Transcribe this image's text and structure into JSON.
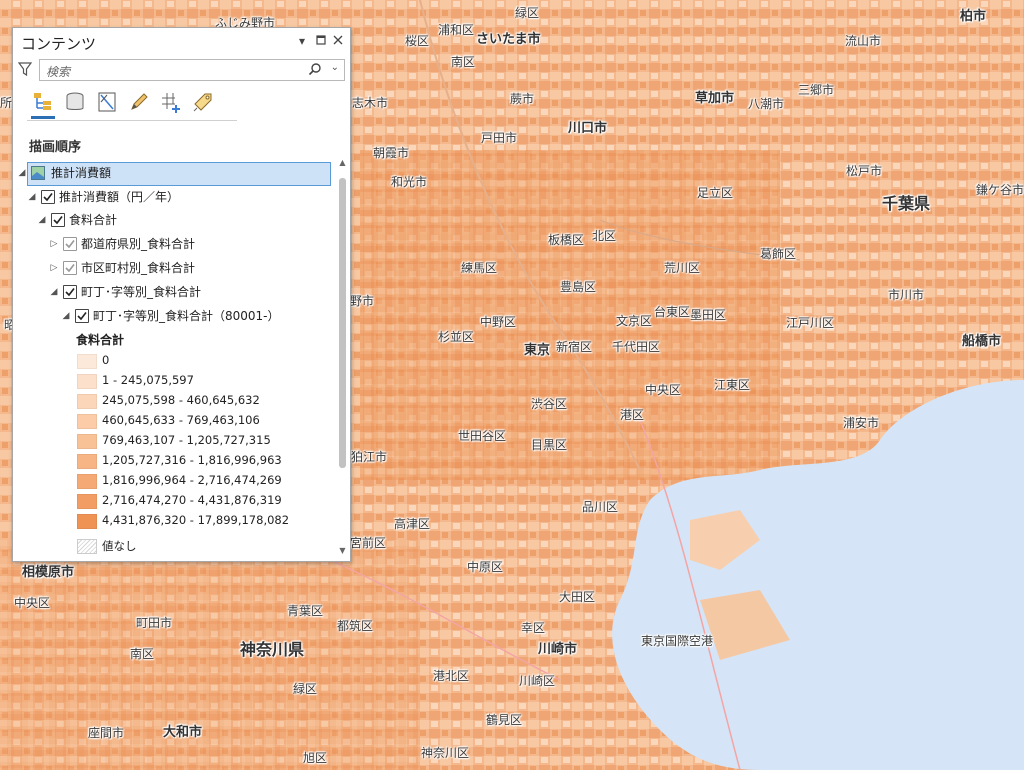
{
  "map": {
    "labels": [
      {
        "text": "ふじみ野市",
        "cls": ""
      },
      {
        "text": "浦和区",
        "cls": ""
      },
      {
        "text": "緑区",
        "cls": ""
      },
      {
        "text": "柏市",
        "cls": "mid"
      },
      {
        "text": "桜区",
        "cls": ""
      },
      {
        "text": "さいたま市",
        "cls": "mid"
      },
      {
        "text": "流山市",
        "cls": ""
      },
      {
        "text": "南区",
        "cls": ""
      },
      {
        "text": "蕨市",
        "cls": ""
      },
      {
        "text": "草加市",
        "cls": "mid"
      },
      {
        "text": "八潮市",
        "cls": ""
      },
      {
        "text": "三郷市",
        "cls": ""
      },
      {
        "text": "志木市",
        "cls": ""
      },
      {
        "text": "戸田市",
        "cls": ""
      },
      {
        "text": "川口市",
        "cls": "mid"
      },
      {
        "text": "朝霞市",
        "cls": ""
      },
      {
        "text": "和光市",
        "cls": ""
      },
      {
        "text": "松戸市",
        "cls": ""
      },
      {
        "text": "足立区",
        "cls": ""
      },
      {
        "text": "鎌ケ谷市",
        "cls": ""
      },
      {
        "text": "千葉県",
        "cls": "big"
      },
      {
        "text": "板橋区",
        "cls": ""
      },
      {
        "text": "北区",
        "cls": ""
      },
      {
        "text": "葛飾区",
        "cls": ""
      },
      {
        "text": "練馬区",
        "cls": ""
      },
      {
        "text": "荒川区",
        "cls": ""
      },
      {
        "text": "豊島区",
        "cls": ""
      },
      {
        "text": "市川市",
        "cls": ""
      },
      {
        "text": "野市",
        "cls": ""
      },
      {
        "text": "台東区",
        "cls": ""
      },
      {
        "text": "中野区",
        "cls": ""
      },
      {
        "text": "文京区",
        "cls": ""
      },
      {
        "text": "墨田区",
        "cls": ""
      },
      {
        "text": "江戸川区",
        "cls": ""
      },
      {
        "text": "杉並区",
        "cls": ""
      },
      {
        "text": "東京",
        "cls": "mid"
      },
      {
        "text": "新宿区",
        "cls": ""
      },
      {
        "text": "千代田区",
        "cls": ""
      },
      {
        "text": "船橋市",
        "cls": "mid"
      },
      {
        "text": "中央区",
        "cls": ""
      },
      {
        "text": "江東区",
        "cls": ""
      },
      {
        "text": "渋谷区",
        "cls": ""
      },
      {
        "text": "港区",
        "cls": ""
      },
      {
        "text": "浦安市",
        "cls": ""
      },
      {
        "text": "世田谷区",
        "cls": ""
      },
      {
        "text": "目黒区",
        "cls": ""
      },
      {
        "text": "狛江市",
        "cls": ""
      },
      {
        "text": "品川区",
        "cls": ""
      },
      {
        "text": "高津区",
        "cls": ""
      },
      {
        "text": "宮前区",
        "cls": ""
      },
      {
        "text": "相模原市",
        "cls": "mid"
      },
      {
        "text": "中原区",
        "cls": ""
      },
      {
        "text": "中央区",
        "cls": ""
      },
      {
        "text": "大田区",
        "cls": ""
      },
      {
        "text": "町田市",
        "cls": ""
      },
      {
        "text": "青葉区",
        "cls": ""
      },
      {
        "text": "都筑区",
        "cls": ""
      },
      {
        "text": "幸区",
        "cls": ""
      },
      {
        "text": "東京国際空港",
        "cls": ""
      },
      {
        "text": "南区",
        "cls": ""
      },
      {
        "text": "神奈川県",
        "cls": "big"
      },
      {
        "text": "川崎市",
        "cls": "mid"
      },
      {
        "text": "港北区",
        "cls": ""
      },
      {
        "text": "川崎区",
        "cls": ""
      },
      {
        "text": "緑区",
        "cls": ""
      },
      {
        "text": "鶴見区",
        "cls": ""
      },
      {
        "text": "座間市",
        "cls": ""
      },
      {
        "text": "大和市",
        "cls": "mid"
      },
      {
        "text": "旭区",
        "cls": ""
      },
      {
        "text": "神奈川区",
        "cls": ""
      },
      {
        "text": "昭",
        "cls": ""
      },
      {
        "text": "所",
        "cls": ""
      }
    ]
  },
  "panel": {
    "title": "コンテンツ",
    "search_placeholder": "検索",
    "section": "描画順序",
    "layers": [
      {
        "label": "推計消費額"
      },
      {
        "label": "推計消費額（円／年）"
      },
      {
        "label": "食料合計"
      },
      {
        "label": "都道府県別_食料合計"
      },
      {
        "label": "市区町村別_食料合計"
      },
      {
        "label": "町丁･字等別_食料合計"
      },
      {
        "label": "町丁･字等別_食料合計（80001-）"
      }
    ],
    "legend_title": "食料合計",
    "legend": [
      {
        "label": "0",
        "color": "#fde9d9"
      },
      {
        "label": "1 - 245,075,597",
        "color": "#fde0cb"
      },
      {
        "label": "245,075,598 - 460,645,632",
        "color": "#fcd6b9"
      },
      {
        "label": "460,645,633 - 769,463,106",
        "color": "#fbcca7"
      },
      {
        "label": "769,463,107 - 1,205,727,315",
        "color": "#f9c196"
      },
      {
        "label": "1,205,727,316 - 1,816,996,963",
        "color": "#f7b585"
      },
      {
        "label": "1,816,996,964 - 2,716,474,269",
        "color": "#f5a974"
      },
      {
        "label": "2,716,474,270 - 4,431,876,319",
        "color": "#f29d63"
      },
      {
        "label": "4,431,876,320 - 17,899,178,082",
        "color": "#ef9355"
      },
      {
        "label": "値なし",
        "color": "hatch"
      }
    ]
  }
}
